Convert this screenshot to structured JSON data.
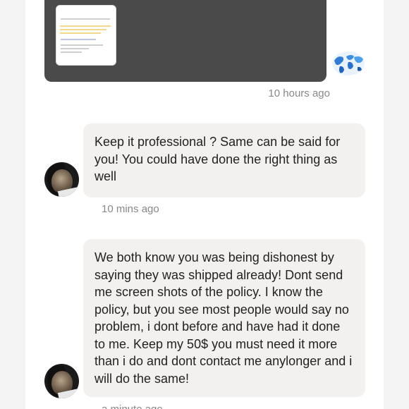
{
  "thread": {
    "image_message": {
      "thumbnail_icon": "document-thumbnail",
      "timestamp": "10 hours ago"
    },
    "sender_avatar_icon": "globe-watercolor-icon",
    "messages": [
      {
        "text": "Keep it professional ? Same can be said for you! You could have done the right thing as well",
        "timestamp": "10 mins ago"
      },
      {
        "text": "We both know you was being dishonest by saying they was shipped already! Dont send me screen shots of the policy. I know the policy, but you see most people would say no problem, i dont before and have had it done to me. Keep my 50$ you must need it more than i do and dont contact me anylonger and i will do the same!",
        "timestamp": "a minute ago"
      }
    ]
  },
  "colors": {
    "bubble": "#f3f1ef",
    "image_bg": "#4a4a4a",
    "timestamp": "#888888",
    "page": "#ffffff"
  }
}
